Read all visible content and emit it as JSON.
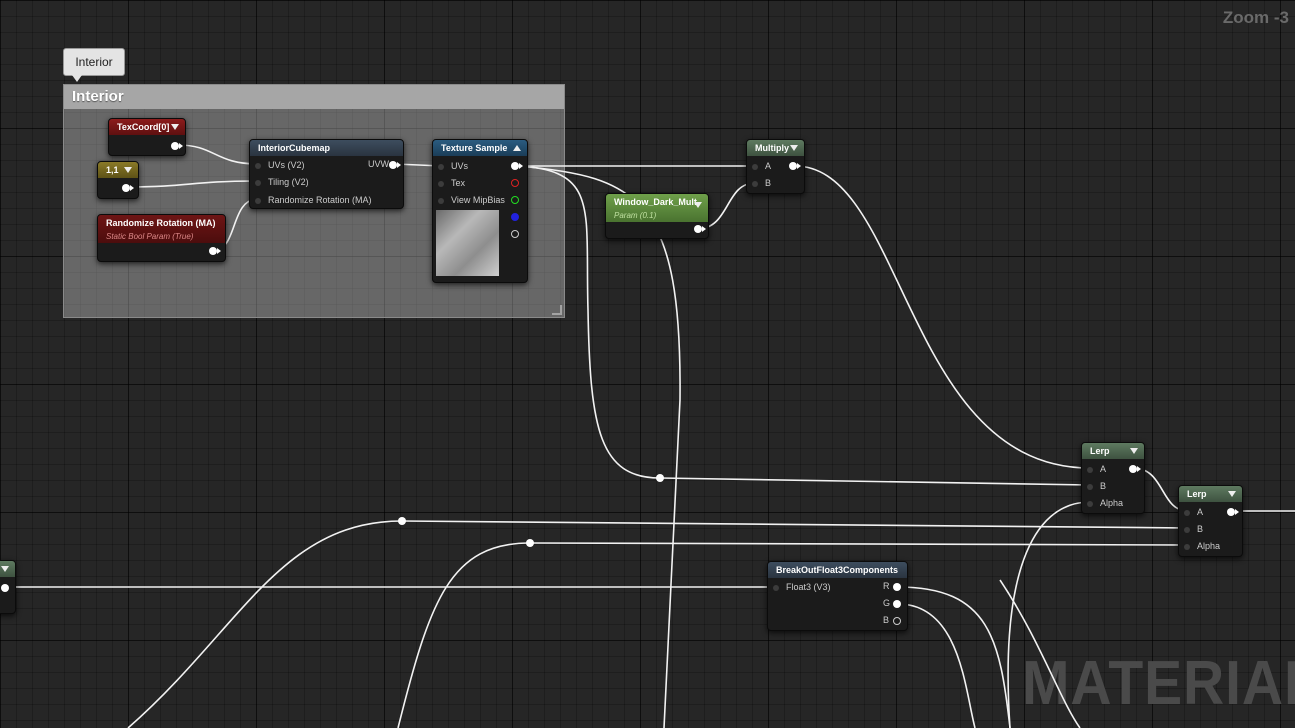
{
  "canvas": {
    "zoom_label": "Zoom -3",
    "watermark": "MATERIAL"
  },
  "comment": {
    "bubble": "Interior",
    "title": "Interior"
  },
  "nodes": {
    "texcoord": {
      "title": "TexCoord[0]"
    },
    "const2": {
      "title": "1,1"
    },
    "randomize": {
      "title": "Randomize Rotation (MA)",
      "subtitle": "Static Bool Param (True)"
    },
    "interior_cubemap": {
      "title": "InteriorCubemap",
      "inputs": [
        "UVs (V2)",
        "Tiling (V2)",
        "Randomize Rotation (MA)"
      ],
      "output": "UVW"
    },
    "texture_sample": {
      "title": "Texture Sample",
      "inputs": [
        "UVs",
        "Tex",
        "View MipBias"
      ]
    },
    "window_dark_mult": {
      "title": "Window_Dark_Mult",
      "subtitle": "Param (0.1)"
    },
    "multiply": {
      "title": "Multiply",
      "inputs": [
        "A",
        "B"
      ]
    },
    "lerp1": {
      "title": "Lerp",
      "inputs": [
        "A",
        "B",
        "Alpha"
      ]
    },
    "lerp2": {
      "title": "Lerp",
      "inputs": [
        "A",
        "B",
        "Alpha"
      ]
    },
    "breakout": {
      "title": "BreakOutFloat3Components",
      "inputs": [
        "Float3 (V3)"
      ],
      "outputs": [
        "R",
        "G",
        "B"
      ]
    }
  },
  "colors": {
    "param_red": "#8c1c1c",
    "constant_olive": "#8a7a28",
    "function_steel": "#3d4d5e",
    "texture_blue": "#2b5c80",
    "scalar_param_green": "#6fa04a",
    "math_green": "#5e7a60",
    "wire": "#ffffff"
  },
  "icons": [
    "dropdown-arrow-icon",
    "collapse-arrow-icon",
    "pin-dot-icon"
  ]
}
